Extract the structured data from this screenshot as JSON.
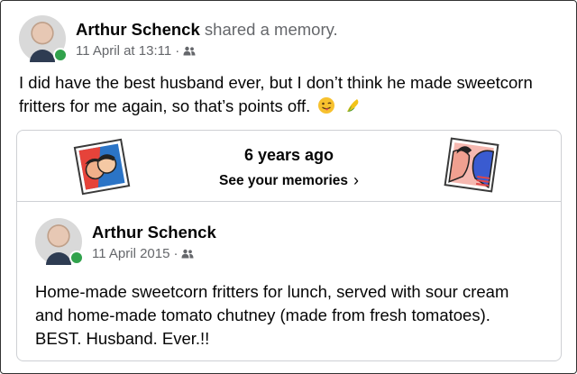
{
  "post": {
    "author": "Arthur Schenck",
    "action": "shared a memory.",
    "timestamp": "11 April at 13:11",
    "separator": "·",
    "audience_icon": "friends-icon",
    "text": "I did have the best husband ever, but I don’t think he made sweetcorn fritters for me again, so that’s points off.",
    "emojis": [
      "winking-face-tongue-icon",
      "corn-icon"
    ]
  },
  "memory_banner": {
    "title": "6 years ago",
    "link_label": "See your memories",
    "link_chevron": "›"
  },
  "shared_post": {
    "author": "Arthur Schenck",
    "timestamp": "11 April 2015",
    "separator": "·",
    "audience_icon": "friends-icon",
    "text": "Home-made sweetcorn fritters for lunch, served with sour cream and home-made tomato chutney (made from fresh tomatoes). BEST. Husband. Ever.!!"
  },
  "colors": {
    "text": "#050505",
    "secondary": "#65676b",
    "online": "#31a24c",
    "border": "#ced0d4"
  }
}
